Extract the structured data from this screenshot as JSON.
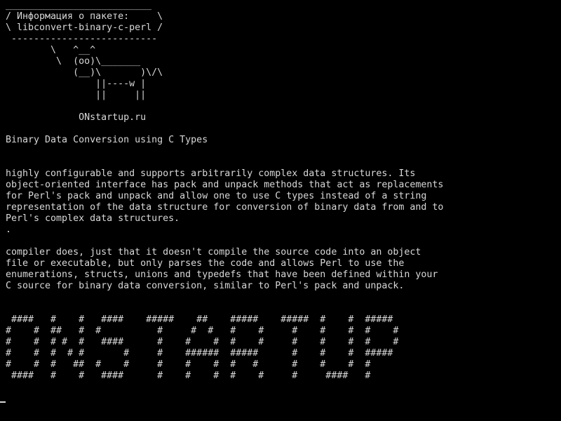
{
  "cowsay": {
    "lines": [
      "__________________________",
      "/ Информация о пакете:     \\",
      "\\ libconvert-binary-c-perl /",
      " --------------------------",
      "        \\   ^__^",
      "         \\  (oo)\\_______",
      "            (__)\\       )\\/\\",
      "                ||----w |",
      "                ||     ||",
      "",
      "             ONstartup.ru"
    ]
  },
  "caption": {
    "line": "Binary Data Conversion using C Types"
  },
  "description": {
    "lines": [
      "highly configurable and supports arbitrarily complex data structures. Its",
      "object-oriented interface has pack and unpack methods that act as replacements",
      "for Perl's pack and unpack and allow one to use C types instead of a string",
      "representation of the data structure for conversion of binary data from and to",
      "Perl's complex data structures.",
      "."
    ]
  },
  "description2": {
    "lines": [
      "compiler does, just that it doesn't compile the source code into an object",
      "file or executable, but only parses the code and allows Perl to use the",
      "enumerations, structs, unions and typedefs that have been defined within your",
      "C source for binary data conversion, similar to Perl's pack and unpack."
    ]
  },
  "banner": {
    "lines": [
      " ####   #    #   ####    #####    ##    #####    #####  #    #  #####",
      "#    #  ##   #  #          #     #  #   #    #     #    #    #  #    #",
      "#    #  # #  #   ####      #    #    #  #    #     #    #    #  #    #",
      "#    #  #  # #       #     #    ######  #####      #    #    #  #####",
      "#    #  #   ##  #    #     #    #    #  #   #      #    #    #  #",
      " ####   #    #   ####      #    #    #  #    #     #     ####   #"
    ]
  },
  "colors": {
    "background": "#000000",
    "foreground": "#d8d8d8"
  }
}
